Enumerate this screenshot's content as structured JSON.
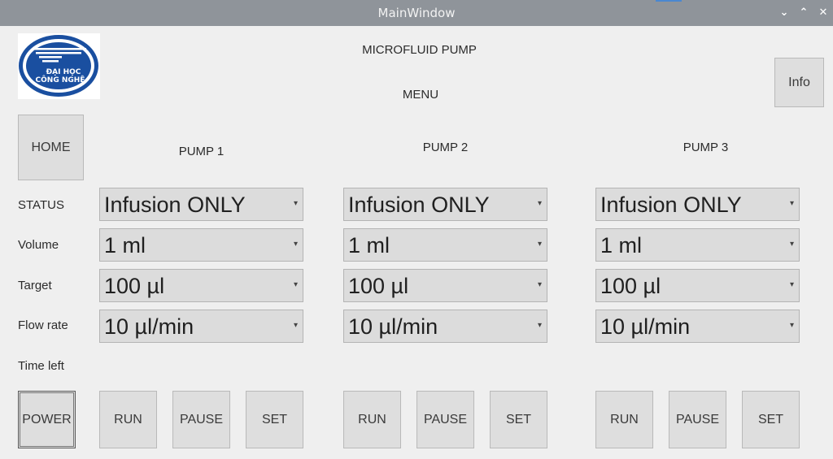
{
  "window": {
    "title": "MainWindow"
  },
  "logo": {
    "text_line1": "ĐẠI HỌC",
    "text_line2": "CÔNG NGHỆ"
  },
  "header": {
    "title": "MICROFLUID PUMP",
    "menu": "MENU"
  },
  "buttons": {
    "info": "Info",
    "home": "HOME",
    "power": "POWER"
  },
  "row_labels": {
    "status": "STATUS",
    "volume": "Volume",
    "target": "Target",
    "flow_rate": "Flow rate",
    "time_left": "Time left"
  },
  "pumps": [
    {
      "title": "PUMP 1",
      "status": "Infusion ONLY",
      "volume": "1 ml",
      "target": "100 µl",
      "flow_rate": "10 µl/min",
      "run": "RUN",
      "pause": "PAUSE",
      "set": "SET"
    },
    {
      "title": "PUMP 2",
      "status": "Infusion ONLY",
      "volume": "1 ml",
      "target": "100 µl",
      "flow_rate": "10 µl/min",
      "run": "RUN",
      "pause": "PAUSE",
      "set": "SET"
    },
    {
      "title": "PUMP 3",
      "status": "Infusion ONLY",
      "volume": "1 ml",
      "target": "100 µl",
      "flow_rate": "10 µl/min",
      "run": "RUN",
      "pause": "PAUSE",
      "set": "SET"
    }
  ],
  "colors": {
    "logo_blue": "#1a4fa0",
    "titlebar": "#8f949a",
    "background": "#efefef"
  }
}
